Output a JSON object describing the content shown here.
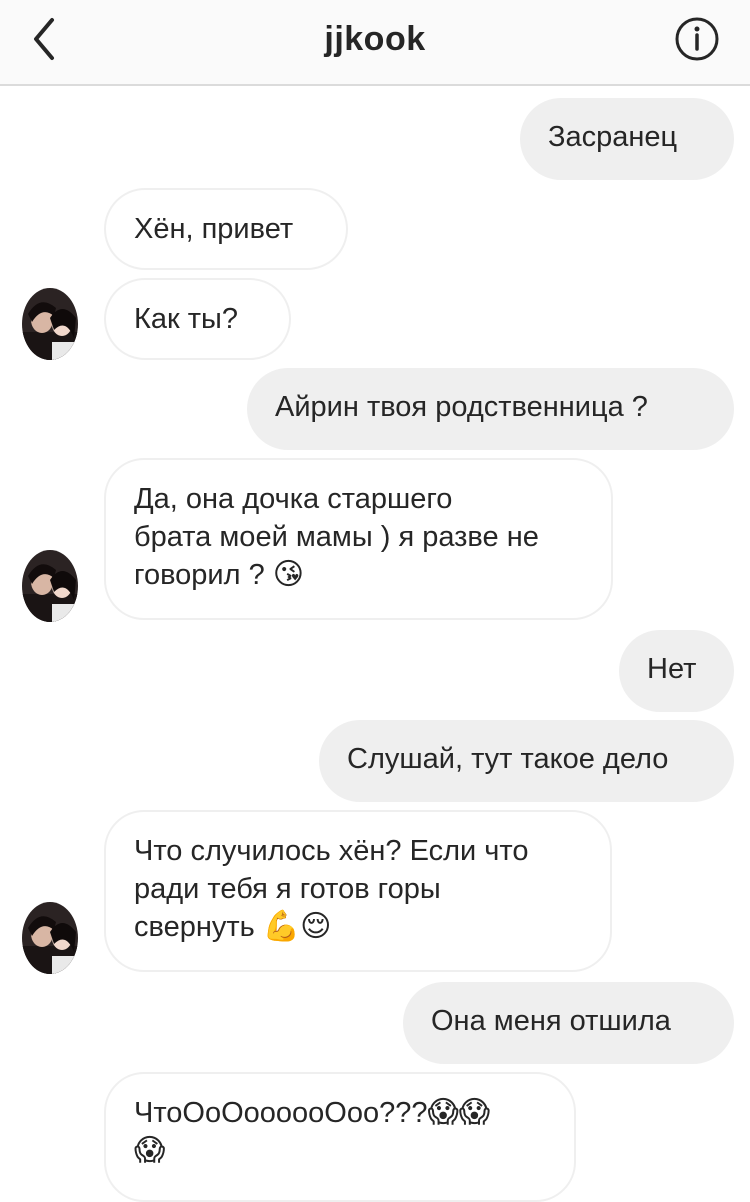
{
  "header": {
    "title": "jjkook"
  },
  "messages": [
    {
      "text": "Засранец"
    },
    {
      "text": "Хён, привет"
    },
    {
      "text": "Как ты?"
    },
    {
      "text": "Айрин твоя родственница ?"
    },
    {
      "line1": "Да, она дочка старшего",
      "line2": "брата моей мамы ) я разве не",
      "line3": "говорил ?",
      "emoji": "😘"
    },
    {
      "text": "Нет"
    },
    {
      "text": "Слушай, тут такое дело"
    },
    {
      "line1": "Что случилось хён? Если что",
      "line2": "ради тебя я готов горы",
      "line3": "свернуть",
      "emoji": "💪😌"
    },
    {
      "text": "Она меня отшила"
    },
    {
      "line1": "ЧтоОоОоооооОоо???",
      "emoji1": "😱😱",
      "emoji2": "😱"
    }
  ],
  "icons": {
    "back": "chevron-left-icon",
    "info": "info-circle-icon",
    "avatar": "contact-avatar"
  }
}
